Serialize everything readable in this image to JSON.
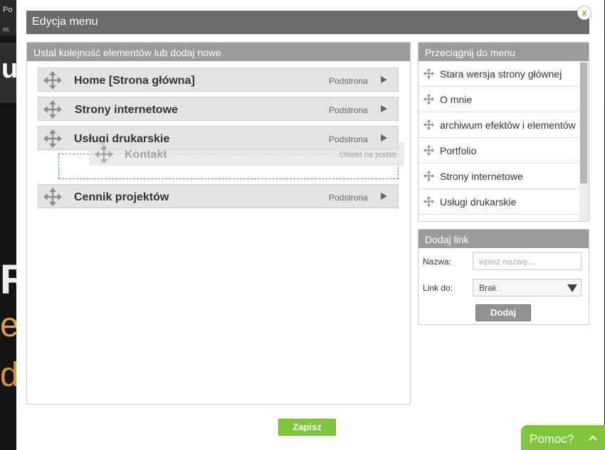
{
  "background": {
    "topbar_text": "Po",
    "topbar_small": "sc",
    "logo_fragment": "ut",
    "big_fragment": "R",
    "orange_fragment_1": "e",
    "orange_fragment_2": "d"
  },
  "modal": {
    "title": "Edycja menu",
    "close_label": "x"
  },
  "menu_panel": {
    "header": "Ustal kolejność elementów lub dodaj nowe",
    "items": [
      {
        "label": "Home [Strona główna]",
        "type": "Podstrona"
      },
      {
        "label": "Strony internetowe",
        "type": "Podstrona"
      },
      {
        "label": "Usługi drukarskie",
        "type": "Podstrona"
      },
      {
        "label": "Cennik projektów",
        "type": "Podstrona"
      }
    ],
    "dragging_item": {
      "label": "Kontakt",
      "type": "Obiekt na podstr"
    }
  },
  "drag_panel": {
    "header": "Przeciągnij do menu",
    "items": [
      "Stara wersja strony głównej",
      "O mnie",
      "archiwum efektów i elementów",
      "Portfolio",
      "Strony internetowe",
      "Usługi drukarskie"
    ]
  },
  "add_link": {
    "header": "Dodaj link",
    "name_label": "Nazwa:",
    "name_placeholder": "wpisz nazwę...",
    "link_label": "Link do:",
    "link_value": "Brak",
    "add_button": "Dodaj"
  },
  "save_button": "Zapisz",
  "help_tab": "Pomoc?",
  "colors": {
    "accent_green": "#80c63b",
    "header_gray": "#6c6c6c",
    "panel_head_gray": "#9b9b9b"
  }
}
